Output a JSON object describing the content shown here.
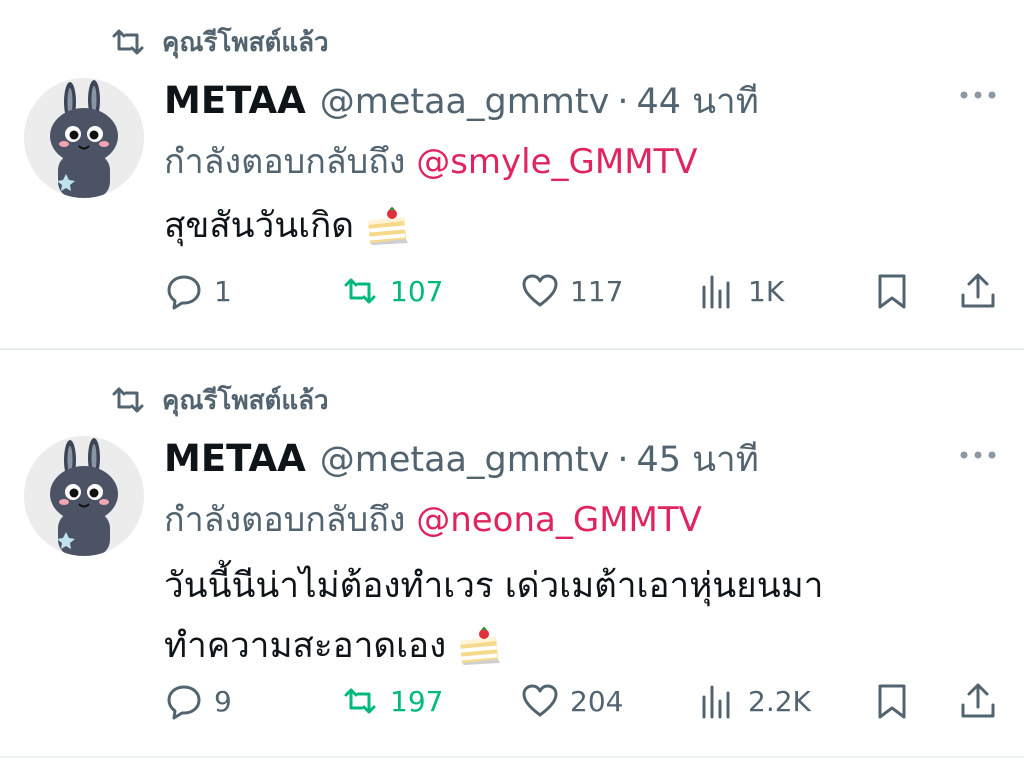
{
  "tweets": [
    {
      "retweet_label": "คุณรีโพสต์แล้ว",
      "display_name": "METAA",
      "handle": "@metaa_gmmtv",
      "separator": "·",
      "time": "44 นาที",
      "reply_prefix": "กำลังตอบกลับถึง",
      "reply_to": "@smyle_GMMTV",
      "text_lines": [
        "สุขสันวันเกิด"
      ],
      "emoji": "cake-slice",
      "replies": "1",
      "retweets": "107",
      "likes": "117",
      "views": "1K"
    },
    {
      "retweet_label": "คุณรีโพสต์แล้ว",
      "display_name": "METAA",
      "handle": "@metaa_gmmtv",
      "separator": "·",
      "time": "45 นาที",
      "reply_prefix": "กำลังตอบกลับถึง",
      "reply_to": "@neona_GMMTV",
      "text_lines": [
        "วันนี้นีน่าไม่ต้องทำเวร เด่วเมต้าเอาหุ่นยนมา",
        "ทำความสะอาดเอง"
      ],
      "emoji": "cake-slice",
      "replies": "9",
      "retweets": "197",
      "likes": "204",
      "views": "2.2K"
    }
  ],
  "colors": {
    "text": "#0f1419",
    "muted": "#536471",
    "mention": "#e0245e",
    "retweet_active": "#00ba7c",
    "divider": "#e6ecf0"
  },
  "icons": [
    "retweet-icon",
    "more-icon",
    "reply-icon",
    "like-icon",
    "views-icon",
    "bookmark-icon",
    "share-icon",
    "cake-emoji-icon"
  ]
}
